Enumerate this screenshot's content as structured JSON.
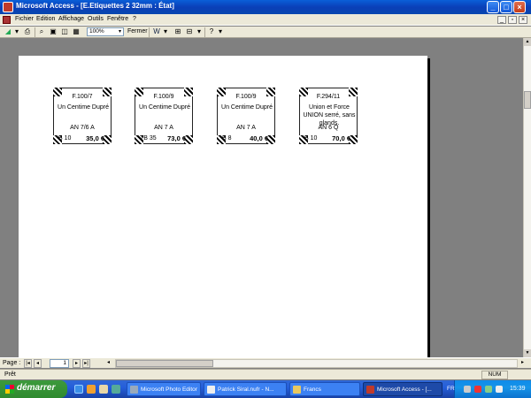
{
  "window": {
    "title": "Microsoft Access - [E.Etiquettes 2 32mm : État]"
  },
  "menu": [
    "Fichier",
    "Edition",
    "Affichage",
    "Outils",
    "Fenêtre",
    "?"
  ],
  "toolbar": {
    "zoom": "100%",
    "close_label": "Fermer"
  },
  "labels": [
    {
      "ref": "F.100/7",
      "desc": "Un Centime Dupré",
      "cond": "AN 7/6 A",
      "grade": "B 10",
      "price": "35,0 €"
    },
    {
      "ref": "F.100/9",
      "desc": "Un Centime Dupré",
      "cond": "AN 7 A",
      "grade": "TB 35",
      "price": "73,0 €"
    },
    {
      "ref": "F.100/9",
      "desc": "Un Centime Dupré",
      "cond": "AN 7 A",
      "grade": "B 8",
      "price": "40,0 €"
    },
    {
      "ref": "F.294/11",
      "desc": "Union et Force UNION serré, sans glands.",
      "cond": "AN 6 Q",
      "grade": "B 10",
      "price": "70,0 €"
    }
  ],
  "nav": {
    "page_label": "Page :",
    "page_number": "1"
  },
  "status": {
    "text": "Prêt",
    "num": "NUM"
  },
  "taskbar": {
    "start": "démarrer",
    "tasks": [
      "Microsoft Photo Editor",
      "Patrick Siral.nufr - N...",
      "Francs",
      "Microsoft Access - [..."
    ],
    "lang": "FR",
    "clock": "15:39"
  }
}
